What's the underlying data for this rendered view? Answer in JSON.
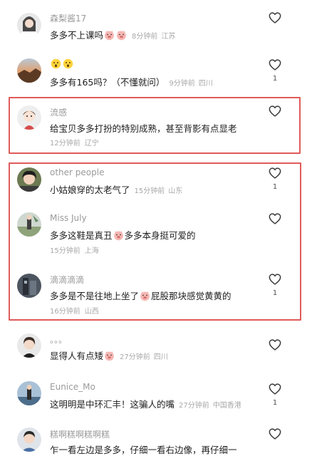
{
  "comments": [
    {
      "user": "森梨酱17",
      "text": "多多不上课吗",
      "emoji_after": 2,
      "time": "8分钟前",
      "location": "江苏",
      "likes": ""
    },
    {
      "user": "",
      "text_emojis": 2,
      "text": "多多有165吗？（不懂就问）",
      "time": "9分钟前",
      "location": "四川",
      "likes": "1"
    },
    {
      "user": "流感",
      "text": "给宝贝多多打扮的特别成熟，甚至背影有点显老",
      "time": "12分钟前",
      "location": "辽宁",
      "likes": ""
    },
    {
      "user": "other people",
      "text": "小姑娘穿的太老气了",
      "time": "15分钟前",
      "location": "山东",
      "likes": "1"
    },
    {
      "user": "Miss July",
      "text_a": "多多这鞋是真丑",
      "text_b": "多多本身挺可爱的",
      "time": "15分钟前",
      "location": "上海",
      "likes": ""
    },
    {
      "user": "滴滴滴滴",
      "text_a": "多多是不是往地上坐了",
      "text_b": "屁股那块感觉黄黄的",
      "time": "16分钟前",
      "location": "山西",
      "likes": "1"
    },
    {
      "user": "。。。",
      "text": "显得人有点矮",
      "time": "27分钟前",
      "location": "四川",
      "likes": ""
    },
    {
      "user": "Eunice_Mo",
      "text": "这明明是中环汇丰！这骗人的嘴",
      "time": "27分钟前",
      "location": "中国香港",
      "likes": "1"
    },
    {
      "user": "糕啊糕啊糕啊糕",
      "text": "乍一看左边是多多，仔细一看右边像，再仔细一",
      "likes": ""
    }
  ],
  "icons": {
    "like": "heart-outline-icon",
    "emoji_pig": "pig-face-emoji-icon",
    "emoji_wow": "surprised-face-emoji-icon"
  },
  "colors": {
    "highlight": "#e05a5a",
    "meta": "#a8a8a8",
    "username": "#9a9a9a"
  }
}
